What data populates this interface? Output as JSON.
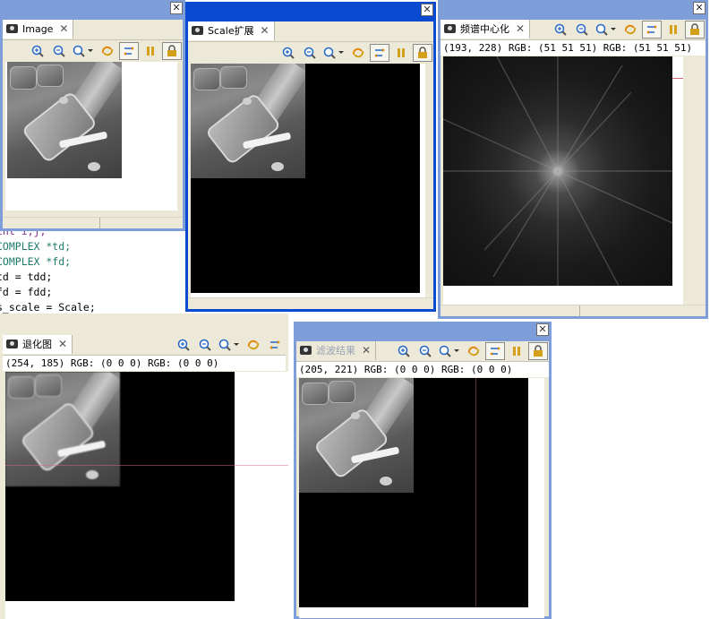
{
  "code": {
    "lines": [
      "int i,j;",
      "COMPLEX *td;",
      "COMPLEX *fd;",
      "td = tdd;",
      "fd = fdd;",
      "s_scale = Scale;"
    ]
  },
  "windows": {
    "image": {
      "tab_label": "Image",
      "close_symbol": "✕"
    },
    "scale": {
      "tab_label": "Scale扩展",
      "close_symbol": "✕"
    },
    "spectrum": {
      "tab_label": "频谱中心化",
      "close_symbol": "✕",
      "status": "(193, 228) RGB: (51 51 51) RGB: (51 51 51)"
    },
    "degrade": {
      "tab_label": "退化图",
      "close_symbol": "✕",
      "status": "(254, 185) RGB: (0 0 0) RGB: (0 0 0)"
    },
    "filter": {
      "tab_label": "滤波结果",
      "close_symbol": "✕",
      "status": "(205, 221) RGB: (0 0 0) RGB: (0 0 0)"
    }
  },
  "toolbar": {
    "icons": [
      "zoom-in-icon",
      "zoom-out-icon",
      "zoom-fit-icon",
      "dropdown-arrow-icon",
      "refresh-icon",
      "sync-icon",
      "pause-icon",
      "lock-icon"
    ]
  },
  "colors": {
    "active_border": "#0a4ad0",
    "inactive_border": "#7d9ed8",
    "panel_bg": "#ece9d8"
  }
}
